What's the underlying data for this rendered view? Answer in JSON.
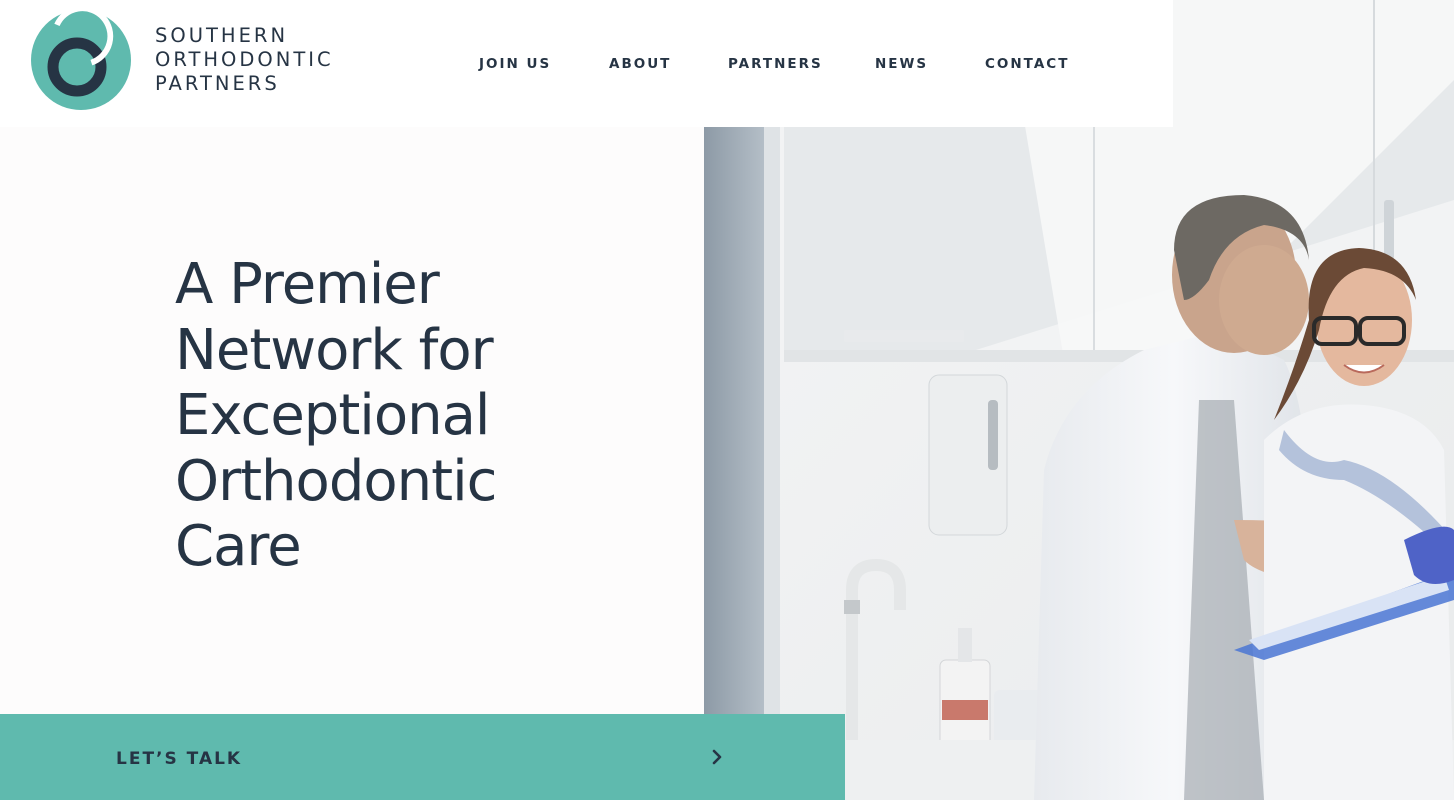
{
  "brand": {
    "lines": [
      "SOUTHERN",
      "ORTHODONTIC",
      "PARTNERS"
    ],
    "logo_icon": "interlocking-rings-logo",
    "colors": {
      "teal": "#5fbaae",
      "navy": "#263444"
    }
  },
  "nav": {
    "items": [
      {
        "label": "JOIN US"
      },
      {
        "label": "ABOUT"
      },
      {
        "label": "PARTNERS"
      },
      {
        "label": "NEWS"
      },
      {
        "label": "CONTACT"
      }
    ]
  },
  "hero": {
    "headline_lines": [
      "A Premier",
      "Network for",
      "Exceptional",
      "Orthodontic",
      "Care"
    ],
    "image_icon": "orthodontists-photo"
  },
  "cta": {
    "label": "LET’S TALK",
    "icon": "chevron-right-icon",
    "color": "#5fbaae"
  }
}
